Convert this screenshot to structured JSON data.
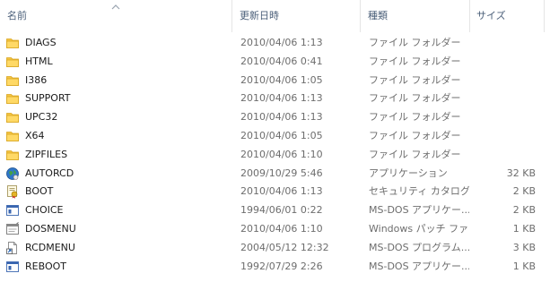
{
  "columns": {
    "name": "名前",
    "date": "更新日時",
    "type": "種類",
    "size": "サイズ"
  },
  "icons": {
    "folder": "folder-icon",
    "app": "application-globe-icon",
    "catalog": "security-catalog-icon",
    "msdos": "msdos-app-icon",
    "pif": "pif-shortcut-icon",
    "program": "msdos-program-icon"
  },
  "files": [
    {
      "name": "DIAGS",
      "date": "2010/04/06 1:13",
      "type": "ファイル フォルダー",
      "size": "",
      "icon": "folder"
    },
    {
      "name": "HTML",
      "date": "2010/04/06 0:41",
      "type": "ファイル フォルダー",
      "size": "",
      "icon": "folder"
    },
    {
      "name": "I386",
      "date": "2010/04/06 1:05",
      "type": "ファイル フォルダー",
      "size": "",
      "icon": "folder"
    },
    {
      "name": "SUPPORT",
      "date": "2010/04/06 1:13",
      "type": "ファイル フォルダー",
      "size": "",
      "icon": "folder"
    },
    {
      "name": "UPC32",
      "date": "2010/04/06 1:13",
      "type": "ファイル フォルダー",
      "size": "",
      "icon": "folder"
    },
    {
      "name": "X64",
      "date": "2010/04/06 1:05",
      "type": "ファイル フォルダー",
      "size": "",
      "icon": "folder"
    },
    {
      "name": "ZIPFILES",
      "date": "2010/04/06 1:10",
      "type": "ファイル フォルダー",
      "size": "",
      "icon": "folder"
    },
    {
      "name": "AUTORCD",
      "date": "2009/10/29 5:46",
      "type": "アプリケーション",
      "size": "32 KB",
      "icon": "app"
    },
    {
      "name": "BOOT",
      "date": "2010/04/06 1:13",
      "type": "セキュリティ カタログ",
      "size": "2 KB",
      "icon": "catalog"
    },
    {
      "name": "CHOICE",
      "date": "1994/06/01 0:22",
      "type": "MS-DOS アプリケー...",
      "size": "2 KB",
      "icon": "msdos"
    },
    {
      "name": "DOSMENU",
      "date": "2010/04/06 1:10",
      "type": "Windows パッチ ファ...",
      "size": "1 KB",
      "icon": "pif"
    },
    {
      "name": "RCDMENU",
      "date": "2004/05/12 12:32",
      "type": "MS-DOS プログラム...",
      "size": "3 KB",
      "icon": "program"
    },
    {
      "name": "REBOOT",
      "date": "1992/07/29 2:26",
      "type": "MS-DOS アプリケー...",
      "size": "1 KB",
      "icon": "msdos"
    }
  ]
}
